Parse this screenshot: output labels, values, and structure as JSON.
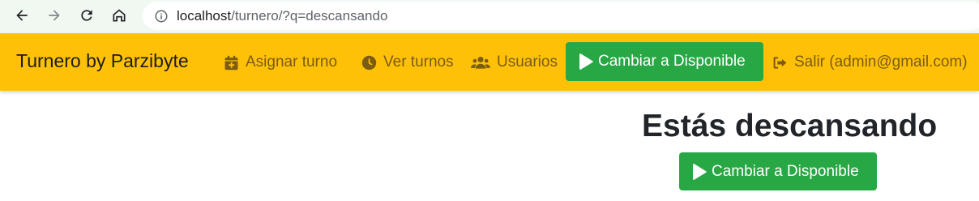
{
  "browser": {
    "url_host": "localhost",
    "url_path": "/turnero/?q=descansando"
  },
  "navbar": {
    "brand": "Turnero by Parzibyte",
    "links": [
      {
        "label": "Asignar turno",
        "icon": "calendar-plus-icon"
      },
      {
        "label": "Ver turnos",
        "icon": "clock-icon"
      },
      {
        "label": "Usuarios",
        "icon": "users-icon"
      }
    ],
    "toggle_button": "Cambiar a Disponible",
    "logout": "Salir (admin@gmail.com)"
  },
  "main": {
    "title": "Estás descansando",
    "button": "Cambiar a Disponible"
  },
  "colors": {
    "navbar": "#ffc107",
    "success": "#28a745",
    "link": "#7a5c12"
  }
}
